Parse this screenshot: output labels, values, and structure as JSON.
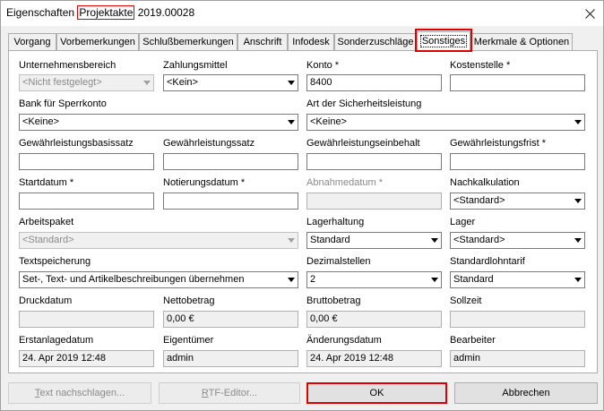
{
  "window": {
    "title_prefix": "Eigenschaften ",
    "title_highlight": "Projektakte",
    "title_suffix": " 2019.00028"
  },
  "tabs": [
    {
      "label": "Vorgang"
    },
    {
      "label": "Vorbemerkungen"
    },
    {
      "label": "Schlußbemerkungen"
    },
    {
      "label": "Anschrift"
    },
    {
      "label": "Infodesk"
    },
    {
      "label": "Sonderzuschläge"
    },
    {
      "label": "Sonstiges",
      "active": true
    },
    {
      "label": "Merkmale & Optionen"
    }
  ],
  "fields": {
    "unternehmensbereich": {
      "label": "Unternehmensbereich",
      "value": "<Nicht festgelegt>"
    },
    "zahlungsmittel": {
      "label": "Zahlungsmittel",
      "value": "<Kein>"
    },
    "konto": {
      "label": "Konto *",
      "value": "8400"
    },
    "kostenstelle": {
      "label": "Kostenstelle *",
      "value": ""
    },
    "bank_sperrkonto": {
      "label": "Bank für Sperrkonto",
      "value": "<Keine>"
    },
    "art_sicherheitsleistung": {
      "label": "Art der Sicherheitsleistung",
      "value": "<Keine>"
    },
    "gewaehrleistungsbasissatz": {
      "label": "Gewährleistungsbasissatz",
      "value": ""
    },
    "gewaehrleistungssatz": {
      "label": "Gewährleistungssatz",
      "value": ""
    },
    "gewaehrleistungseinbehalt": {
      "label": "Gewährleistungseinbehalt",
      "value": ""
    },
    "gewaehrleistungsfrist": {
      "label": "Gewährleistungsfrist *",
      "value": ""
    },
    "startdatum": {
      "label": "Startdatum *",
      "value": ""
    },
    "notierungsdatum": {
      "label": "Notierungsdatum *",
      "value": ""
    },
    "abnahmedatum": {
      "label": "Abnahmedatum *",
      "value": ""
    },
    "nachkalkulation": {
      "label": "Nachkalkulation",
      "value": "<Standard>"
    },
    "arbeitspaket": {
      "label": "Arbeitspaket",
      "value": "<Standard>"
    },
    "lagerhaltung": {
      "label": "Lagerhaltung",
      "value": "Standard"
    },
    "lager": {
      "label": "Lager",
      "value": "<Standard>"
    },
    "textspeicherung": {
      "label": "Textspeicherung",
      "value": "Set-, Text- und Artikelbeschreibungen übernehmen"
    },
    "dezimalstellen": {
      "label": "Dezimalstellen",
      "value": "2"
    },
    "standardlohntarif": {
      "label": "Standardlohntarif",
      "value": "Standard"
    },
    "druckdatum": {
      "label": "Druckdatum",
      "value": ""
    },
    "nettobetrag": {
      "label": "Nettobetrag",
      "value": "0,00 €"
    },
    "bruttobetrag": {
      "label": "Bruttobetrag",
      "value": "0,00 €"
    },
    "sollzeit": {
      "label": "Sollzeit",
      "value": ""
    },
    "erstanlagedatum": {
      "label": "Erstanlagedatum",
      "value": "24. Apr 2019 12:48"
    },
    "eigentuemer": {
      "label": "Eigentümer",
      "value": "admin"
    },
    "aenderungsdatum": {
      "label": "Änderungsdatum",
      "value": "24. Apr 2019 12:48"
    },
    "bearbeiter": {
      "label": "Bearbeiter",
      "value": "admin"
    }
  },
  "buttons": {
    "text_nachschlagen_u": "T",
    "text_nachschlagen_rest": "ext nachschlagen...",
    "rtf_editor_u": "R",
    "rtf_editor_rest": "TF-Editor...",
    "ok": "OK",
    "abbrechen": "Abbrechen"
  },
  "colors": {
    "highlight": "#e00000",
    "panel": "#ffffff",
    "chrome": "#f0f0f0"
  }
}
